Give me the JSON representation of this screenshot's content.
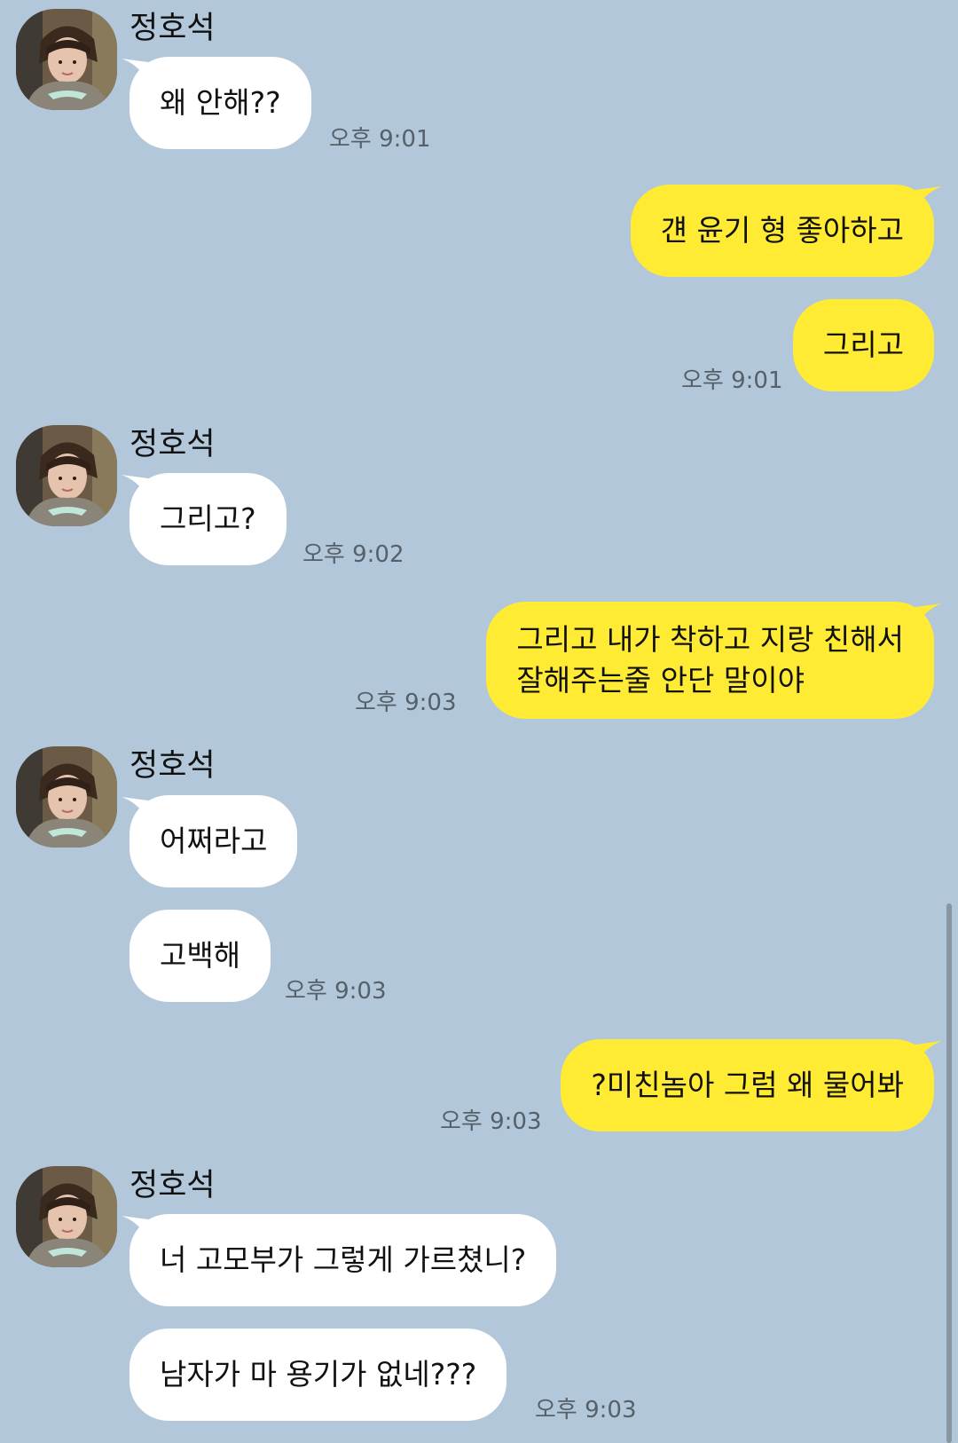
{
  "sender_name": "정호석",
  "messages": [
    {
      "side": "in",
      "text": "왜 안해??",
      "time": "오후 9:01"
    },
    {
      "side": "out",
      "text": "걘 윤기 형 좋아하고"
    },
    {
      "side": "out",
      "text": "그리고",
      "time": "오후 9:01"
    },
    {
      "side": "in",
      "text": "그리고?",
      "time": "오후 9:02"
    },
    {
      "side": "out",
      "line1": "그리고 내가 착하고 지랑 친해서",
      "line2": "잘해주는줄 안단 말이야",
      "time": "오후 9:03"
    },
    {
      "side": "in",
      "text": "어쩌라고"
    },
    {
      "side": "in",
      "text": "고백해",
      "time": "오후 9:03"
    },
    {
      "side": "out",
      "text": "?미친놈아 그럼 왜 물어봐",
      "time": "오후 9:03"
    },
    {
      "side": "in",
      "text": "너 고모부가 그렇게 가르쳤니?"
    },
    {
      "side": "in",
      "text": "남자가 마 용기가 없네???",
      "time": "오후 9:03"
    }
  ]
}
